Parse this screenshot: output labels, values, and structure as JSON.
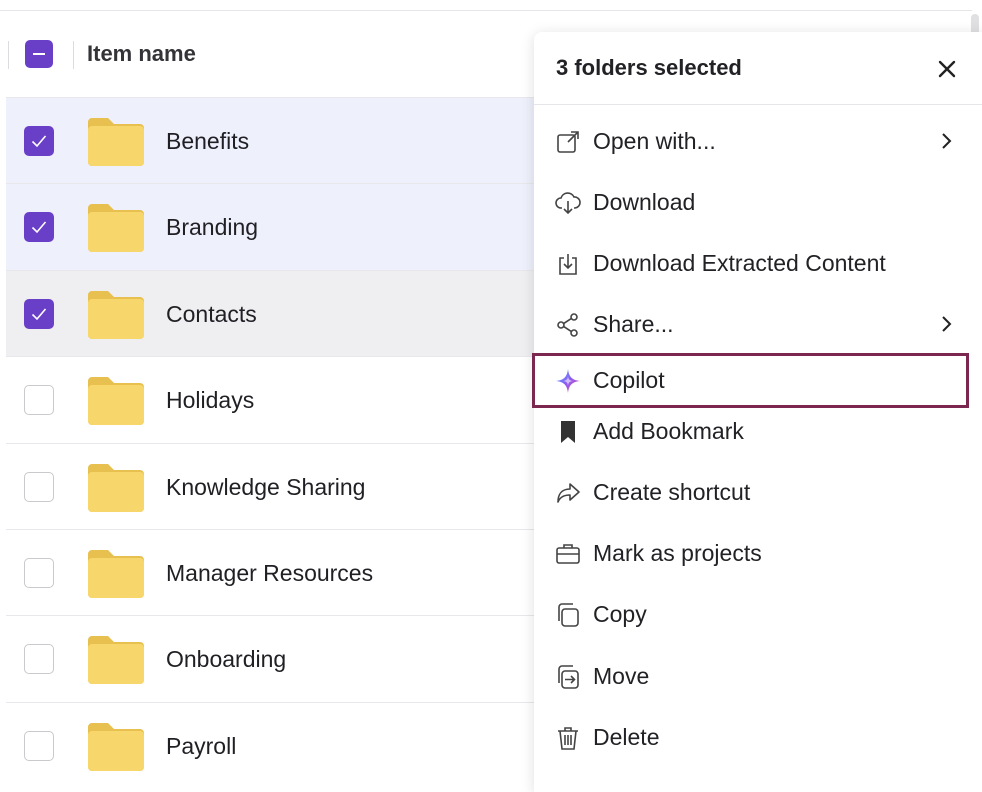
{
  "list": {
    "header_label": "Item name",
    "rows": [
      {
        "name": "Benefits",
        "checked": true
      },
      {
        "name": "Branding",
        "checked": true
      },
      {
        "name": "Contacts",
        "checked": true
      },
      {
        "name": "Holidays",
        "checked": false
      },
      {
        "name": "Knowledge Sharing",
        "checked": false
      },
      {
        "name": "Manager Resources",
        "checked": false
      },
      {
        "name": "Onboarding",
        "checked": false
      },
      {
        "name": "Payroll",
        "checked": false
      }
    ]
  },
  "menu": {
    "title": "3 folders selected",
    "items": [
      {
        "label": "Open with...",
        "icon": "external-link-icon",
        "submenu": true
      },
      {
        "label": "Download",
        "icon": "cloud-download-icon",
        "submenu": false
      },
      {
        "label": "Download Extracted Content",
        "icon": "download-tray-icon",
        "submenu": false
      },
      {
        "label": "Share...",
        "icon": "share-icon",
        "submenu": true
      },
      {
        "label": "Copilot",
        "icon": "copilot-sparkle-icon",
        "submenu": false
      },
      {
        "label": "Add Bookmark",
        "icon": "bookmark-icon",
        "submenu": false
      },
      {
        "label": "Create shortcut",
        "icon": "shortcut-arrow-icon",
        "submenu": false
      },
      {
        "label": "Mark as projects",
        "icon": "briefcase-icon",
        "submenu": false
      },
      {
        "label": "Copy",
        "icon": "copy-icon",
        "submenu": false
      },
      {
        "label": "Move",
        "icon": "move-icon",
        "submenu": false
      },
      {
        "label": "Delete",
        "icon": "trash-icon",
        "submenu": false
      }
    ]
  },
  "colors": {
    "accent": "#6a3fc8",
    "selected_row": "#eef0fb",
    "folder": "#f7d66b",
    "highlight_border": "#7b2750"
  }
}
